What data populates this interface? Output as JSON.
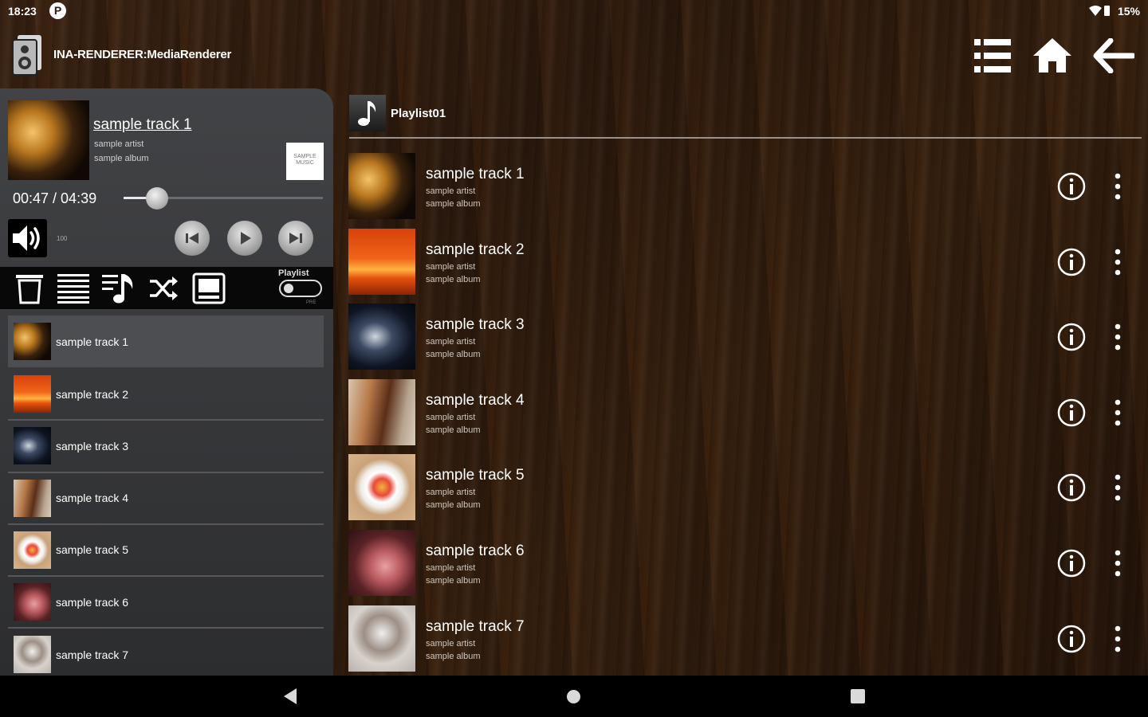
{
  "status_bar": {
    "time": "18:23",
    "notification_letter": "P",
    "battery": "15%"
  },
  "header": {
    "renderer_name": "INA-RENDERER:MediaRenderer"
  },
  "now_playing": {
    "title": "sample track 1",
    "artist": "sample artist",
    "album": "sample album",
    "badge_text": "SAMPLE MUSIC",
    "time": "00:47 / 04:39",
    "progress_fraction": 0.168,
    "volume": "100"
  },
  "toolbar": {
    "playlist_toggle_label": "Playlist",
    "playlist_toggle_sub": "PRE"
  },
  "queue": [
    {
      "label": "sample track 1"
    },
    {
      "label": "sample track 2"
    },
    {
      "label": "sample track 3"
    },
    {
      "label": "sample track 4"
    },
    {
      "label": "sample track 5"
    },
    {
      "label": "sample track 6"
    },
    {
      "label": "sample track 7"
    }
  ],
  "playlist": {
    "name": "Playlist01",
    "tracks": [
      {
        "title": "sample track 1",
        "artist": "sample artist",
        "album": "sample album"
      },
      {
        "title": "sample track 2",
        "artist": "sample artist",
        "album": "sample album"
      },
      {
        "title": "sample track 3",
        "artist": "sample artist",
        "album": "sample album"
      },
      {
        "title": "sample track 4",
        "artist": "sample artist",
        "album": "sample album"
      },
      {
        "title": "sample track 5",
        "artist": "sample artist",
        "album": "sample album"
      },
      {
        "title": "sample track 6",
        "artist": "sample artist",
        "album": "sample album"
      },
      {
        "title": "sample track 7",
        "artist": "sample artist",
        "album": "sample album"
      }
    ]
  },
  "icons": {
    "header": [
      "speaker-icon",
      "list-icon",
      "home-icon",
      "back-arrow-icon"
    ],
    "toolbar": [
      "trash-icon",
      "queue-list-icon",
      "add-to-playlist-icon",
      "shuffle-icon",
      "screen-icon"
    ],
    "transport": [
      "previous-icon",
      "play-icon",
      "next-icon"
    ],
    "track_actions": [
      "info-icon",
      "more-vert-icon"
    ]
  },
  "colors": {
    "wood_dark": "#2c1a0e",
    "panel": "#3a3b3e",
    "text": "#ffffff"
  }
}
